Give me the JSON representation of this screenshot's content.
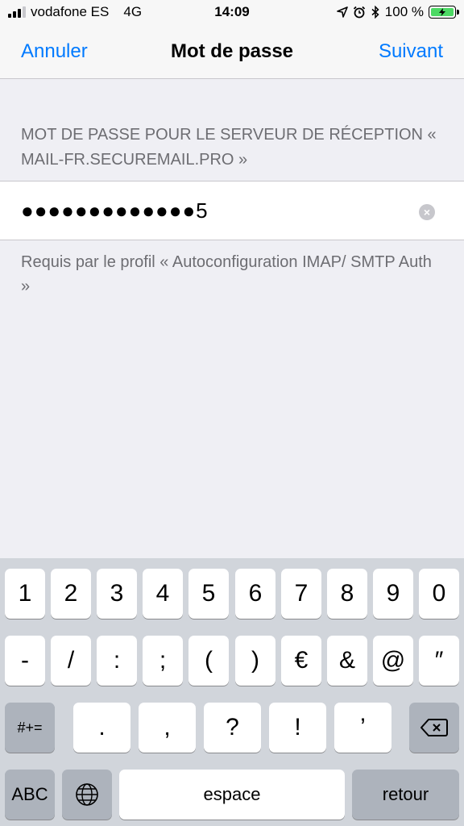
{
  "status_bar": {
    "carrier": "vodafone ES",
    "network": "4G",
    "time": "14:09",
    "battery_percent": "100 %",
    "battery_level": 1.0,
    "icons": [
      "signal-icon",
      "location-icon",
      "alarm-icon",
      "bluetooth-icon",
      "battery-icon"
    ]
  },
  "nav": {
    "cancel_label": "Annuler",
    "title": "Mot de passe",
    "next_label": "Suivant"
  },
  "form": {
    "section_header": "MOT DE PASSE POUR LE SERVEUR DE RÉCEPTION « MAIL-FR.SECUREMAIL.PRO »",
    "password_value": "●●●●●●●●●●●●●5",
    "clear_icon": "clear-icon",
    "footer_note": "Requis par le profil « Autoconfiguration IMAP/ SMTP Auth »"
  },
  "keyboard": {
    "row1": [
      "1",
      "2",
      "3",
      "4",
      "5",
      "6",
      "7",
      "8",
      "9",
      "0"
    ],
    "row2": [
      "-",
      "/",
      ":",
      ";",
      "(",
      ")",
      "€",
      "&",
      "@",
      "″"
    ],
    "row3": {
      "shift_label": "#+=",
      "keys": [
        ".",
        ",",
        "?",
        "!",
        "’"
      ],
      "delete_icon": "delete-icon"
    },
    "row4": {
      "abc_label": "ABC",
      "globe_icon": "globe-icon",
      "space_label": "espace",
      "return_label": "retour"
    }
  },
  "colors": {
    "accent": "#007aff",
    "background": "#efeff4",
    "battery_green": "#4cd964"
  }
}
